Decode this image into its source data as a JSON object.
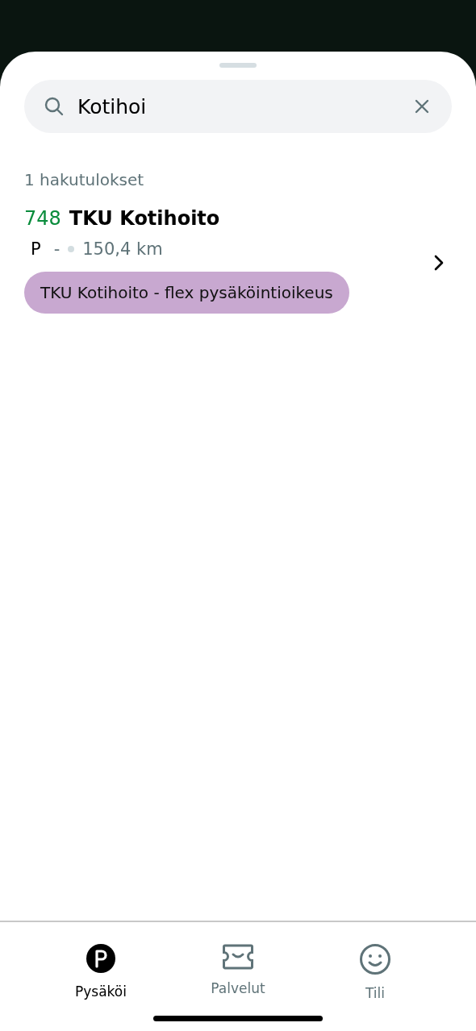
{
  "search": {
    "value": "Kotihoi"
  },
  "results_count": "1 hakutulokset",
  "results": [
    {
      "number": "748",
      "name": "TKU Kotihoito",
      "type_letter": "P",
      "price": "-",
      "distance": "150,4 km",
      "tags": [
        {
          "label": "TKU Kotihoito - flex pysäköintioikeus",
          "color": "#c8a8d0"
        }
      ]
    }
  ],
  "tabs": [
    {
      "label": "Pysäköi",
      "selected": true
    },
    {
      "label": "Palvelut",
      "selected": false
    },
    {
      "label": "Tili",
      "selected": false
    }
  ]
}
